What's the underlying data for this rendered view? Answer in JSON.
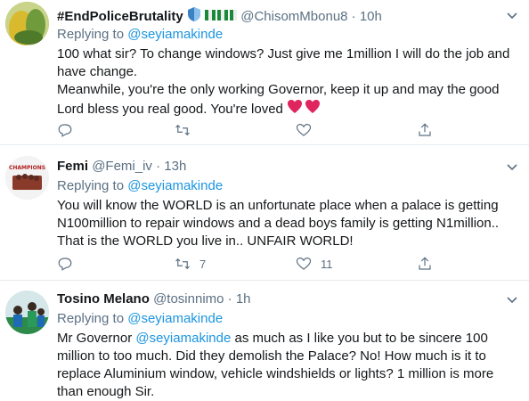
{
  "tweets": [
    {
      "name": "#EndPoliceBrutality",
      "handle": "@ChisomMbonu8",
      "sep": "·",
      "time": "10h",
      "replying_prefix": "Replying to ",
      "replying_to": "@seyiamakinde",
      "lines": [
        "100 what sir? To change windows? Just give me 1million I will do the job and",
        "have change.",
        "Meanwhile, you're the only working Governor, keep it up and may the good",
        "Lord bless you real good. You're loved"
      ],
      "emoji": "heart-heart",
      "reply_count": "",
      "retweet_count": "",
      "like_count": ""
    },
    {
      "name": "Femi",
      "handle": "@Femi_iv",
      "sep": "·",
      "time": "13h",
      "replying_prefix": "Replying to ",
      "replying_to": "@seyiamakinde",
      "lines": [
        "You will know the WORLD is an unfortunate place when a palace is getting",
        "N100million to repair windows and a dead boys family is getting N1million..",
        "That is the WORLD you live in.. UNFAIR WORLD!"
      ],
      "avatar_text": "CHAMPIONS",
      "reply_count": "",
      "retweet_count": "7",
      "like_count": "11"
    },
    {
      "name": "Tosino Melano",
      "handle": "@tosinnimo",
      "sep": "·",
      "time": "1h",
      "replying_prefix": "Replying to ",
      "replying_to": "@seyiamakinde",
      "line1_a": "Mr Governor ",
      "line1_mention": "@seyiamakinde",
      "line1_b": " as much as I like you but to be sincere 100",
      "lines": [
        "million to too much. Did they demolish the Palace? No! How much is it to",
        "replace Aluminium window, vehicle windshields or lights? 1 million is more",
        "than enough Sir."
      ]
    }
  ],
  "colors": {
    "accent": "#1b95e0",
    "secondary": "#5b7083",
    "heart": "#e0245e"
  },
  "icons": [
    "verified-shield-icon",
    "nigeria-flag-icon",
    "more-chevron-icon",
    "reply-icon",
    "retweet-icon",
    "like-icon",
    "share-icon"
  ]
}
